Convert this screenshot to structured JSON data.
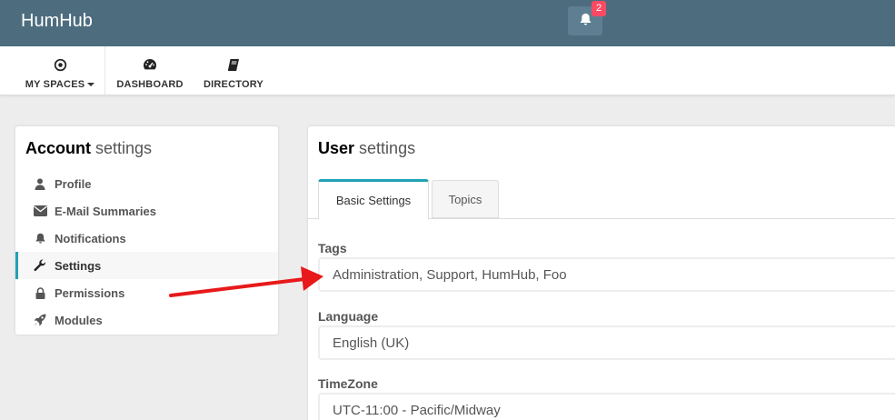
{
  "app": {
    "brand": "HumHub"
  },
  "notifications": {
    "count": "2",
    "icon": "bell-icon"
  },
  "nav": {
    "items": [
      {
        "label": "MY SPACES",
        "icon": "circle-dot-icon"
      },
      {
        "label": "DASHBOARD",
        "icon": "dashboard-gauge-icon"
      },
      {
        "label": "DIRECTORY",
        "icon": "book-icon"
      }
    ]
  },
  "account": {
    "title_bold": "Account",
    "title_light": "settings",
    "menu": [
      {
        "label": "Profile",
        "icon": "user-icon"
      },
      {
        "label": "E-Mail Summaries",
        "icon": "envelope-icon"
      },
      {
        "label": "Notifications",
        "icon": "bell-icon"
      },
      {
        "label": "Settings",
        "icon": "wrench-icon",
        "active": true
      },
      {
        "label": "Permissions",
        "icon": "lock-icon"
      },
      {
        "label": "Modules",
        "icon": "rocket-icon"
      }
    ]
  },
  "user_settings": {
    "title_bold": "User",
    "title_light": "settings",
    "tabs": [
      {
        "label": "Basic Settings",
        "active": true
      },
      {
        "label": "Topics",
        "active": false
      }
    ],
    "fields": {
      "tags": {
        "label": "Tags",
        "value": "Administration, Support, HumHub, Foo"
      },
      "language": {
        "label": "Language",
        "value": "English (UK)"
      },
      "timezone": {
        "label": "TimeZone",
        "value": "UTC-11:00 - Pacific/Midway"
      }
    }
  },
  "colors": {
    "topbar": "#4d6d7f",
    "accent": "#21a1b3",
    "badge": "#fc4a64",
    "annotation_arrow": "#e8191a"
  }
}
